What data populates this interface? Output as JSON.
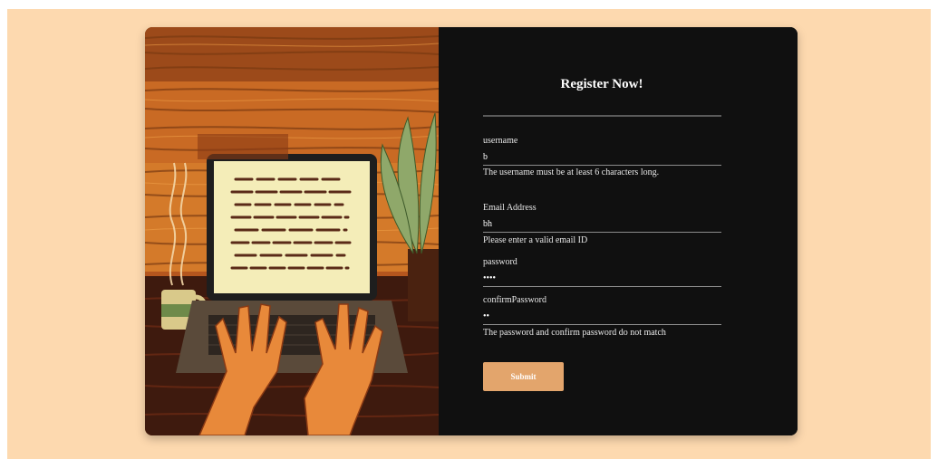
{
  "colors": {
    "page_background": "#FDD9AF",
    "form_background": "#101010",
    "accent": "#E3A56C"
  },
  "form": {
    "title": "Register Now!",
    "fields": [
      {
        "label": "username",
        "value": "b",
        "error": "The username must be at least 6 characters long."
      },
      {
        "label": "Email Address",
        "value": "bh",
        "error": "Please enter a valid email ID"
      },
      {
        "label": "password",
        "value": "abcd",
        "error": ""
      },
      {
        "label": "confirmPassword",
        "value": "ab",
        "error": "The password and confirm password do not match"
      }
    ],
    "submit_label": "Submit"
  },
  "illustration": {
    "icon": "laptop-typing-illustration"
  }
}
